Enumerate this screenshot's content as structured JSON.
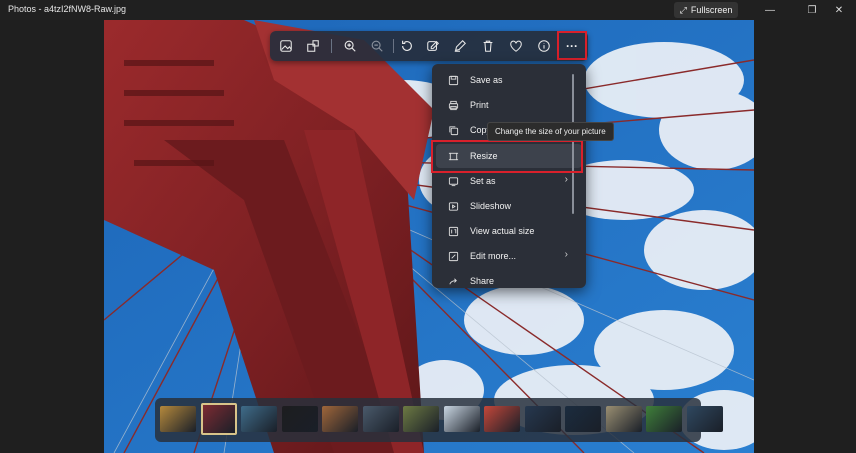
{
  "window": {
    "title": "Photos - a4tzI2fNW8-Raw.jpg",
    "fullscreen_label": "Fullscreen",
    "minimize_glyph": "—",
    "maximize_glyph": "❐",
    "close_glyph": "✕"
  },
  "toolbar": {
    "items": [
      "image-icon",
      "crop-icon",
      "zoom-in-icon",
      "zoom-out-icon",
      "rotate-icon",
      "edit-image-icon",
      "draw-icon",
      "delete-icon",
      "favorite-icon",
      "info-icon",
      "more-icon"
    ],
    "more_glyph": "···"
  },
  "menu": {
    "items": [
      {
        "label": "Save as",
        "icon": "save-icon"
      },
      {
        "label": "Print",
        "icon": "print-icon"
      },
      {
        "label": "Copy",
        "icon": "copy-icon"
      },
      {
        "label": "Resize",
        "icon": "resize-icon"
      },
      {
        "label": "Set as",
        "icon": "set-as-icon",
        "submenu": true
      },
      {
        "label": "Slideshow",
        "icon": "slideshow-icon"
      },
      {
        "label": "View actual size",
        "icon": "actual-size-icon"
      },
      {
        "label": "Edit more...",
        "icon": "edit-more-icon",
        "submenu": true
      },
      {
        "label": "Share",
        "icon": "share-icon"
      }
    ],
    "chevron": "›"
  },
  "tooltip": {
    "text": "Change the size of your picture"
  },
  "filmstrip": {
    "selected_index": 1,
    "thumbnails": [
      "#b5893c",
      "#7d2b32",
      "#3f6c8a",
      "#1d1d1f",
      "#a0663a",
      "#4a5a6b",
      "#6d7a43",
      "#c9d6e2",
      "#c4473a",
      "#26384f",
      "#1b2c3f",
      "#9a8f72",
      "#3f7f3a",
      "#2f4860"
    ]
  },
  "colors": {
    "highlight": "#d9202b",
    "accent": "#d8c48a"
  }
}
